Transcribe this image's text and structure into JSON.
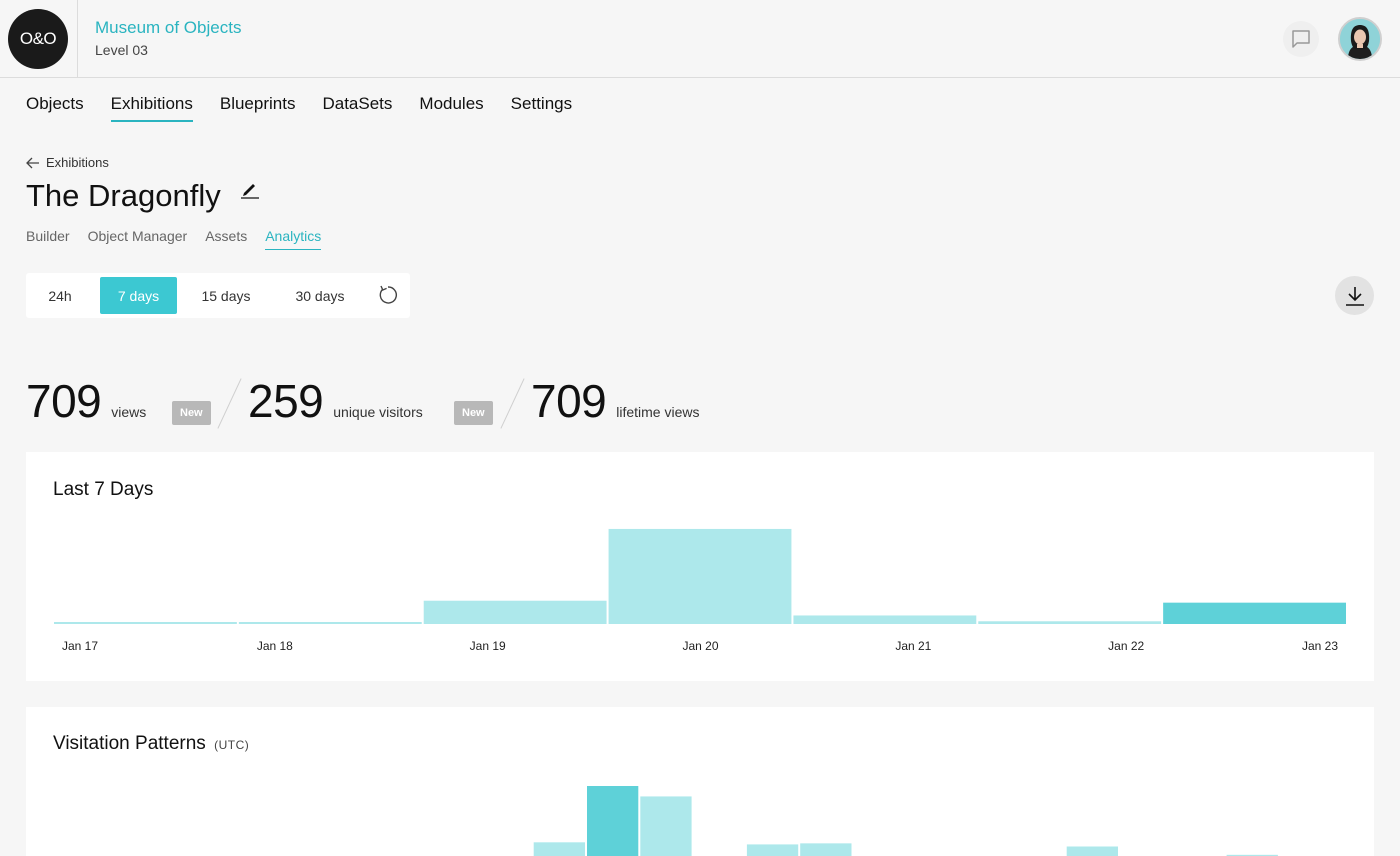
{
  "header": {
    "logo_text": "O&O",
    "org_name": "Museum of Objects",
    "level": "Level 03"
  },
  "main_nav": [
    "Objects",
    "Exhibitions",
    "Blueprints",
    "DataSets",
    "Modules",
    "Settings"
  ],
  "main_nav_active": "Exhibitions",
  "breadcrumb": {
    "back_label": "Exhibitions"
  },
  "page": {
    "title": "The Dragonfly"
  },
  "sub_tabs": [
    "Builder",
    "Object Manager",
    "Assets",
    "Analytics"
  ],
  "sub_tabs_active": "Analytics",
  "time_range": {
    "options": [
      "24h",
      "7 days",
      "15 days",
      "30 days"
    ],
    "selected": "7 days"
  },
  "stats": {
    "views": {
      "value": "709",
      "label": "views",
      "badge": "New"
    },
    "unique": {
      "value": "259",
      "label": "unique visitors",
      "badge": "New"
    },
    "lifetime": {
      "value": "709",
      "label": "lifetime views"
    }
  },
  "colors": {
    "accent": "#2ab4c0",
    "bar_light": "#ade8eb",
    "bar_dark": "#5ed1d8",
    "button_active": "#3cc8d2"
  },
  "chart_data": [
    {
      "type": "bar",
      "title": "Last 7 Days",
      "categories": [
        "Jan 17",
        "Jan 18",
        "Jan 19",
        "Jan 20",
        "Jan 21",
        "Jan 22",
        "Jan 23"
      ],
      "values": [
        5,
        5,
        60,
        245,
        22,
        7,
        55
      ],
      "highlight_index": 6,
      "ylim": [
        0,
        250
      ]
    },
    {
      "type": "bar",
      "title": "Visitation Patterns",
      "title_suffix": "(UTC)",
      "values": [
        0,
        0,
        0,
        0,
        0,
        0,
        0,
        0,
        0,
        16,
        70,
        60,
        1,
        14,
        15,
        0,
        0,
        0,
        0,
        12,
        0,
        0,
        4,
        0
      ],
      "highlight_index": 10
    }
  ]
}
